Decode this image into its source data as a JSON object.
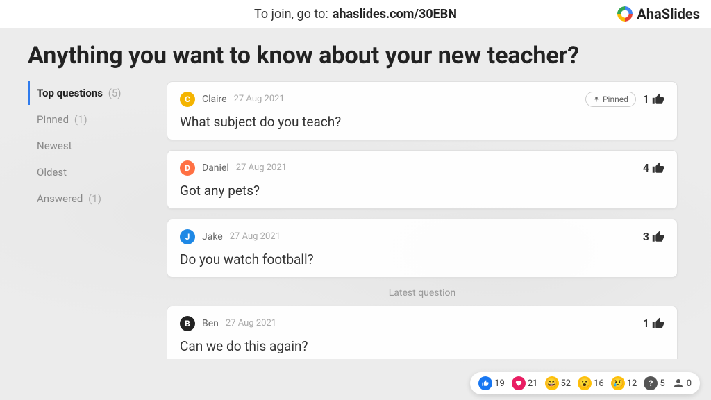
{
  "header": {
    "join_text": "To join, go to:",
    "join_url": "ahaslides.com/30EBN",
    "brand": "AhaSlides"
  },
  "title": "Anything you want to know about your new teacher?",
  "sidebar": {
    "items": [
      {
        "label": "Top questions",
        "count": "(5)",
        "active": true
      },
      {
        "label": "Pinned",
        "count": "(1)",
        "active": false
      },
      {
        "label": "Newest",
        "count": "",
        "active": false
      },
      {
        "label": "Oldest",
        "count": "",
        "active": false
      },
      {
        "label": "Answered",
        "count": "(1)",
        "active": false
      }
    ]
  },
  "questions": [
    {
      "initial": "C",
      "avatar_color": "#f4b400",
      "author": "Claire",
      "date": "27 Aug 2021",
      "pinned": true,
      "pinned_label": "Pinned",
      "likes": "1",
      "text": "What subject do you teach?"
    },
    {
      "initial": "D",
      "avatar_color": "#ff7043",
      "author": "Daniel",
      "date": "27 Aug 2021",
      "pinned": false,
      "likes": "4",
      "text": "Got any pets?"
    },
    {
      "initial": "J",
      "avatar_color": "#1e88e5",
      "author": "Jake",
      "date": "27 Aug 2021",
      "pinned": false,
      "likes": "3",
      "text": "Do you watch football?"
    }
  ],
  "latest_label": "Latest question",
  "latest_question": {
    "initial": "B",
    "avatar_color": "#222",
    "author": "Ben",
    "date": "27 Aug 2021",
    "likes": "1",
    "text": "Can we do this again?"
  },
  "reactions": {
    "like": "19",
    "heart": "21",
    "laugh": "52",
    "wow": "16",
    "sad": "12",
    "q": "5",
    "people": "0"
  }
}
